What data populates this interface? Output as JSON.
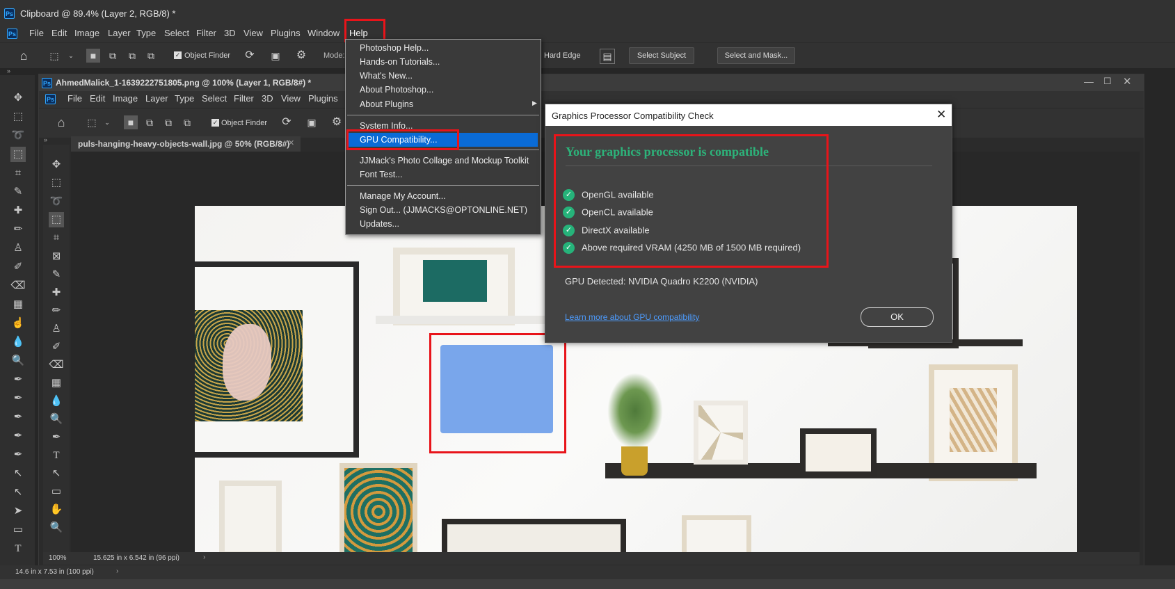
{
  "main_window": {
    "title": "Clipboard @ 89.4% (Layer 2, RGB/8) *",
    "menu": [
      "File",
      "Edit",
      "Image",
      "Layer",
      "Type",
      "Select",
      "Filter",
      "3D",
      "View",
      "Plugins",
      "Window",
      "Help"
    ],
    "options": {
      "object_finder": "Object Finder",
      "mode": "Mode:",
      "hard_edge": "Hard Edge",
      "select_subject": "Select Subject",
      "select_and_mask": "Select and Mask..."
    },
    "status": "14.6 in x 7.53 in (100 ppi)"
  },
  "inner_window": {
    "title": "AhmedMalick_1-1639222751805.png @ 100% (Layer 1, RGB/8#) *",
    "menu": [
      "File",
      "Edit",
      "Image",
      "Layer",
      "Type",
      "Select",
      "Filter",
      "3D",
      "View",
      "Plugins"
    ],
    "object_finder": "Object Finder",
    "doc_tab": "puls-hanging-heavy-objects-wall.jpg @ 50% (RGB/8#)",
    "zoom": "100%",
    "doc_size": "15.625 in x 6.542 in (96 ppi)"
  },
  "help_menu": {
    "items": [
      "Photoshop Help...",
      "Hands-on Tutorials...",
      "What's New...",
      "About Photoshop...",
      "About Plugins",
      "System Info...",
      "GPU Compatibility...",
      "JJMack's Photo Collage and Mockup Toolkit",
      "Font Test...",
      "Manage My Account...",
      "Sign Out... (JJMACKS@OPTONLINE.NET)",
      "Updates..."
    ],
    "highlighted": "GPU Compatibility..."
  },
  "gpu_dialog": {
    "title": "Graphics Processor Compatibility Check",
    "heading": "Your graphics processor is compatible",
    "checks": [
      "OpenGL available",
      "OpenCL available",
      "DirectX available",
      "Above required VRAM (4250 MB of 1500 MB required)"
    ],
    "gpu_detected": "GPU Detected: NVIDIA Quadro K2200 (NVIDIA)",
    "learn_more": "Learn more about GPU compatibility",
    "ok": "OK"
  },
  "colors": {
    "accent_green": "#2db37a",
    "highlight_blue": "#0a6bd6",
    "annotation_red": "#e8141a",
    "link_blue": "#4d9cff"
  }
}
